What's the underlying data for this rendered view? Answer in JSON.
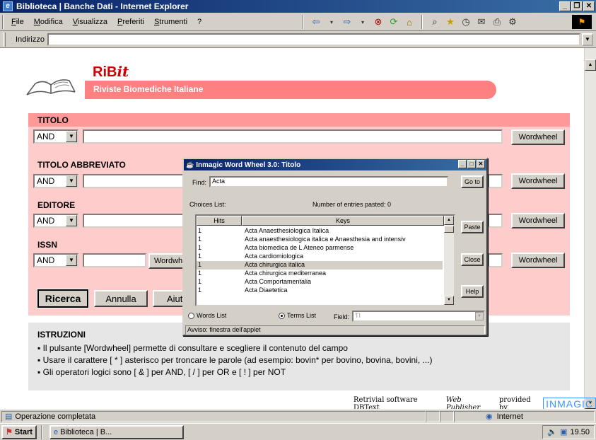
{
  "window": {
    "title": "Biblioteca | Banche Dati - Internet Explorer"
  },
  "menu": [
    "File",
    "Modifica",
    "Visualizza",
    "Preferiti",
    "Strumenti",
    "?"
  ],
  "address": {
    "label": "Indirizzo",
    "value": ""
  },
  "header": {
    "logo_prefix": "RiB",
    "logo_suffix": "it",
    "subtitle": "Riviste Biomediche Italiane"
  },
  "fields": [
    {
      "label": "TITOLO",
      "operator": "AND",
      "value": "",
      "button": "Wordwheel"
    },
    {
      "label": "TITOLO ABBREVIATO",
      "operator": "AND",
      "value": "",
      "button": "Wordwheel"
    },
    {
      "label": "EDITORE",
      "operator": "AND",
      "value": "",
      "button": "Wordwheel"
    },
    {
      "label": "ISSN",
      "operator": "AND",
      "value": "",
      "button": "Wordwh",
      "button2": "Wordwheel"
    }
  ],
  "actions": {
    "search": "Ricerca",
    "cancel": "Annulla",
    "help": "Aiut"
  },
  "instructions": {
    "title": "ISTRUZIONI",
    "lines": [
      "▪ Il pulsante [Wordwheel] permette di consultare e scegliere il contenuto del campo",
      "▪ Usare il carattere [ * ] asterisco per troncare le parole (ad esempio: bovin* per bovino, bovina, bovini, ...)",
      "▪ Gli operatori logici sono [ & ] per AND, [ / ] per OR e [ ! ] per NOT"
    ]
  },
  "credit": {
    "text_a": "Retrivial software DBText",
    "text_b": "Web Publisher",
    "text_c": "provided by",
    "brand": "INMAGIC"
  },
  "status": {
    "text": "Operazione completata",
    "zone": "Internet"
  },
  "taskbar": {
    "start": "Start",
    "item": "Biblioteca | B...",
    "time": "19.50"
  },
  "wordwheel": {
    "title": "Inmagic Word Wheel 3.0: Titolo",
    "find_label": "Find:",
    "find_value": "Acta",
    "goto": "Go to",
    "choices_label": "Choices List:",
    "pasted_label": "Number of entries pasted: 0",
    "col_hits": "Hits",
    "col_keys": "Keys",
    "rows": [
      {
        "hits": "1",
        "key": "Acta Anaesthesiologica Italica"
      },
      {
        "hits": "1",
        "key": "Acta anaesthesiologica italica e Anaesthesia and intensiv"
      },
      {
        "hits": "1",
        "key": "Acta biomedica de L Ateneo parmense"
      },
      {
        "hits": "1",
        "key": "Acta cardiomiologica"
      },
      {
        "hits": "1",
        "key": "Acta chirurgica italica"
      },
      {
        "hits": "1",
        "key": "Acta chirurgica mediterranea"
      },
      {
        "hits": "1",
        "key": "Acta Comportamentalia"
      },
      {
        "hits": "1",
        "key": "Acta Diaetetica"
      }
    ],
    "paste": "Paste",
    "close": "Close",
    "help": "Help",
    "words_list": "Words List",
    "terms_list": "Terms List",
    "field_label": "Field:",
    "field_value": "TI",
    "applet_note": "Avviso: finestra dell'applet"
  }
}
